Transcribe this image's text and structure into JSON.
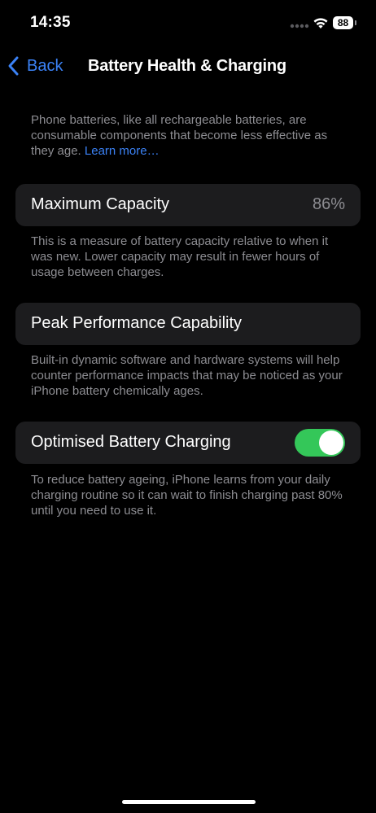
{
  "status_bar": {
    "time": "14:35",
    "battery_level": "88"
  },
  "nav": {
    "back_label": "Back",
    "title": "Battery Health & Charging"
  },
  "intro": {
    "text": "Phone batteries, like all rechargeable batteries, are consumable components that become less effective as they age. ",
    "link": "Learn more…"
  },
  "maximum_capacity": {
    "label": "Maximum Capacity",
    "value": "86%",
    "description": "This is a measure of battery capacity relative to when it was new. Lower capacity may result in fewer hours of usage between charges."
  },
  "peak_performance": {
    "label": "Peak Performance Capability",
    "description": "Built-in dynamic software and hardware systems will help counter performance impacts that may be noticed as your iPhone battery chemically ages."
  },
  "optimised_charging": {
    "label": "Optimised Battery Charging",
    "enabled": true,
    "description": "To reduce battery ageing, iPhone learns from your daily charging routine so it can wait to finish charging past 80% until you need to use it."
  },
  "colors": {
    "accent": "#3b82f6",
    "toggle_on": "#34c759",
    "cell_bg": "#1c1c1e",
    "secondary_text": "#8d8d92"
  }
}
